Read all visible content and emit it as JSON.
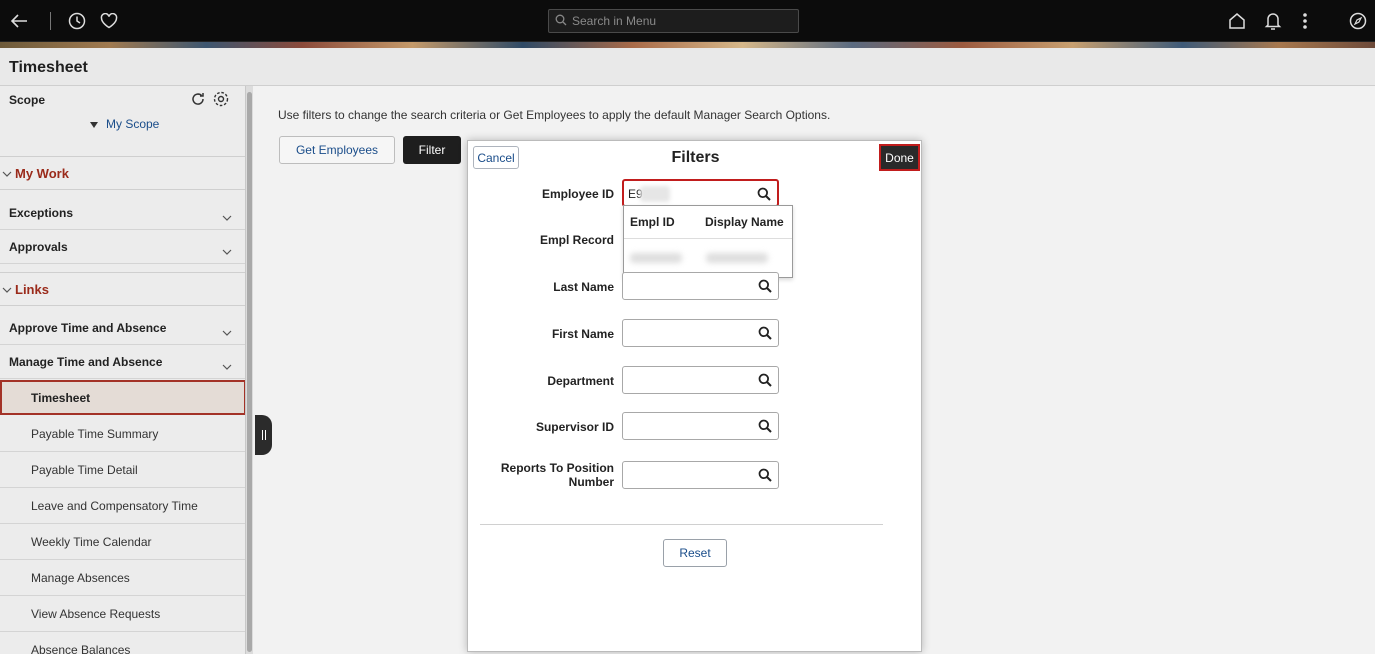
{
  "topbar": {
    "search_placeholder": "Search in Menu",
    "icons": [
      "back-arrow-icon",
      "history-icon",
      "favorite-heart-icon",
      "search-icon",
      "home-icon",
      "notification-bell-icon",
      "actions-menu-icon",
      "navbar-compass-icon"
    ]
  },
  "page": {
    "title": "Timesheet"
  },
  "sidebar": {
    "scope_label": "Scope",
    "my_scope": "My Scope",
    "my_work": "My Work",
    "exceptions": "Exceptions",
    "approvals": "Approvals",
    "links": "Links",
    "approve_time": "Approve Time and Absence",
    "manage_time": "Manage Time and Absence",
    "items": [
      {
        "label": "Timesheet",
        "active": true
      },
      {
        "label": "Payable Time Summary"
      },
      {
        "label": "Payable Time Detail"
      },
      {
        "label": "Leave and Compensatory Time"
      },
      {
        "label": "Weekly Time Calendar"
      },
      {
        "label": "Manage Absences"
      },
      {
        "label": "View Absence Requests"
      },
      {
        "label": "Absence Balances"
      }
    ]
  },
  "main": {
    "instructions": "Use filters to change the search criteria or Get Employees to apply the default Manager Search Options.",
    "get_employees": "Get Employees",
    "filter": "Filter"
  },
  "modal": {
    "title": "Filters",
    "cancel": "Cancel",
    "done": "Done",
    "employee_id_label": "Employee ID",
    "employee_id_value": "E9",
    "empl_record_label": "Empl Record",
    "last_name_label": "Last Name",
    "first_name_label": "First Name",
    "department_label": "Department",
    "supervisor_id_label": "Supervisor ID",
    "reports_to_label_1": "Reports To Position",
    "reports_to_label_2": "Number",
    "dropdown_col1": "Empl ID",
    "dropdown_col2": "Display Name",
    "reset": "Reset"
  },
  "colors": {
    "accent_red": "#c11d1d",
    "link_blue": "#1a4d8a",
    "section_red": "#9a2a1a"
  }
}
